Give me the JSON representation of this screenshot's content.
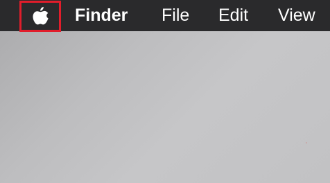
{
  "menubar": {
    "apple_icon": "apple-logo-icon",
    "highlight_color": "#e11d2b",
    "background_color": "#2a2a2c",
    "app_name": "Finder",
    "items": [
      {
        "label": "File"
      },
      {
        "label": "Edit"
      },
      {
        "label": "View"
      }
    ]
  }
}
